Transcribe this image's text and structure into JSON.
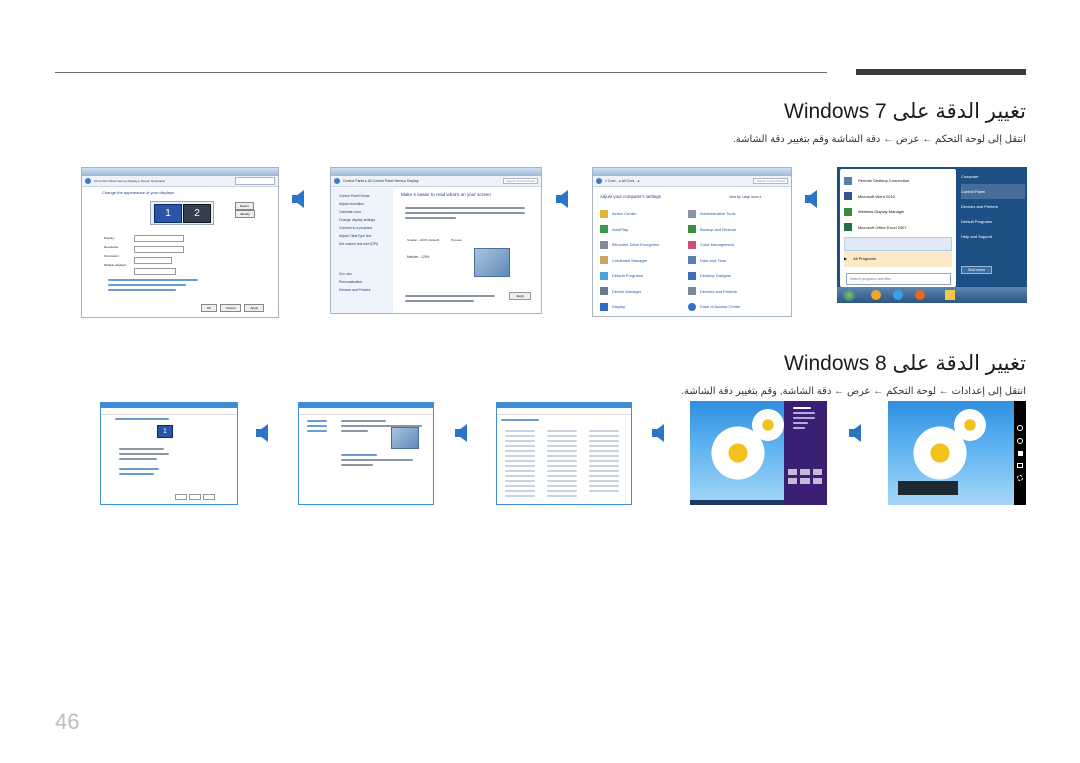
{
  "win7": {
    "heading": "تغيير الدقة على Windows 7",
    "instructions": "انتقل إلى لوحة التحكم ← عرض ← دقة الشاشة وقم بتغيير دقة الشاشة."
  },
  "win8": {
    "heading": "تغيير الدقة على Windows 8",
    "instructions": "انتقل إلى إعدادات ← لوحة التحكم ← عرض ← دقة الشاشة, وقم بتغيير دقة الشاشة."
  },
  "win7_screens": {
    "resolution": {
      "address": "All Control Panel Items ▸ Display ▸ Screen Resolution",
      "title": "Change the appearance of your displays",
      "detect": "Detect",
      "identify": "Identify",
      "display_label": "Display:",
      "resolution_label": "Resolution:",
      "orientation_label": "Orientation:",
      "multiple_label": "Multiple displays:",
      "ok": "OK",
      "cancel": "Cancel",
      "apply": "Apply"
    },
    "display": {
      "address": "Control Panel ▸ All Control Panel Items ▸ Display",
      "search": "Search Control Panel",
      "sidebar": [
        "Control Panel Home",
        "Adjust resolution",
        "Calibrate color",
        "Change display settings",
        "Connect to a projector",
        "Adjust ClearType text",
        "Set custom text size (DPI)"
      ],
      "see_also_title": "See also",
      "see_also": [
        "Personalization",
        "Devices and Printers"
      ],
      "title": "Make it easier to read what's on your screen",
      "smaller": "Smaller - 100% (default)",
      "medium": "Medium - 125%",
      "preview": "Preview",
      "apply": "Apply"
    },
    "control_panel": {
      "address": "« Cont... ▸ All Cont... ▸",
      "search": "Search Control Panel",
      "title": "Adjust your computer's settings",
      "view_by": "View by:",
      "view_mode": "Large icons ▾",
      "items_left": [
        "Action Center",
        "AutoPlay",
        "BitLocker Drive Encryption",
        "Credential Manager",
        "Default Programs",
        "Device Manager",
        "Display"
      ],
      "items_right": [
        "Administrative Tools",
        "Backup and Restore",
        "Color Management",
        "Date and Time",
        "Desktop Gadgets",
        "Devices and Printers",
        "Ease of Access Center"
      ]
    },
    "start_menu": {
      "programs": [
        "Remote Desktop Connection",
        "Microsoft Word 2010",
        "Wireless Display Manager",
        "Microsoft Office Excel 2007"
      ],
      "all_programs": "All Programs",
      "search_placeholder": "Search programs and files",
      "right_items": [
        "Computer",
        "Control Panel",
        "Devices and Printers",
        "Default Programs",
        "Help and Support"
      ],
      "shut_down": "Shut down"
    }
  },
  "page": {
    "number": "46"
  }
}
